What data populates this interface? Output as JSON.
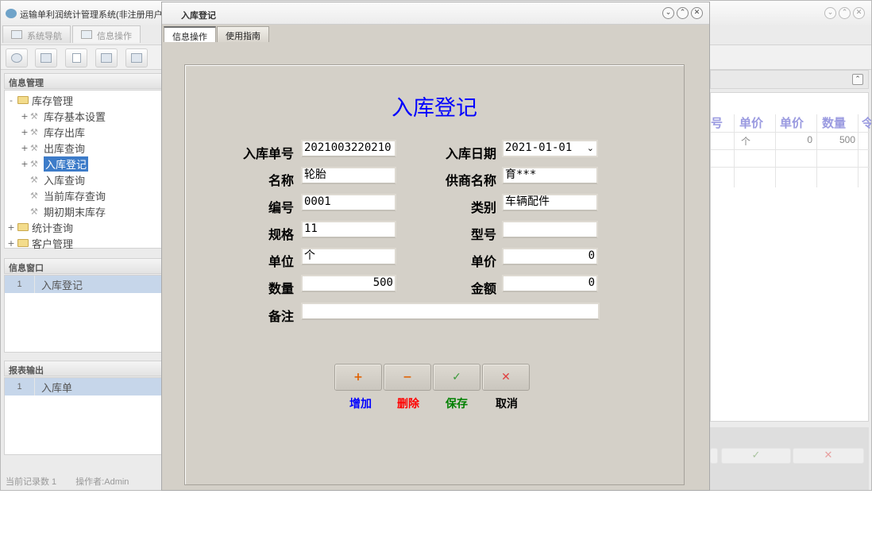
{
  "main_window": {
    "title": "运输单利润统计管理系统(非注册用户",
    "window_buttons": [
      "⌄",
      "⌃",
      "✕"
    ],
    "tabs": [
      {
        "label": "系统导航",
        "active": false
      },
      {
        "label": "信息操作",
        "active": true
      }
    ],
    "left_panel": {
      "info_management_header": "信息管理",
      "tree": [
        {
          "label": "库存管理",
          "level": 0,
          "expander": "-",
          "icon": "folder-icon"
        },
        {
          "label": "库存基本设置",
          "level": 1,
          "expander": "+",
          "icon": "tools-icon"
        },
        {
          "label": "库存出库",
          "level": 1,
          "expander": "+",
          "icon": "tools-icon"
        },
        {
          "label": "出库查询",
          "level": 1,
          "expander": "+",
          "icon": "tools-icon"
        },
        {
          "label": "入库登记",
          "level": 1,
          "expander": "+",
          "icon": "tools-icon",
          "selected": true
        },
        {
          "label": "入库查询",
          "level": 1,
          "expander": "",
          "icon": "tools-icon"
        },
        {
          "label": "当前库存查询",
          "level": 1,
          "expander": "",
          "icon": "tools-icon"
        },
        {
          "label": "期初期末库存",
          "level": 1,
          "expander": "",
          "icon": "tools-icon"
        },
        {
          "label": "统计查询",
          "level": 0,
          "expander": "+",
          "icon": "folder-icon"
        },
        {
          "label": "客户管理",
          "level": 0,
          "expander": "+",
          "icon": "folder-icon"
        }
      ],
      "info_window_header": "信息窗口",
      "info_window_rows": [
        {
          "index": "1",
          "label": "入库登记"
        }
      ],
      "report_header": "报表输出",
      "report_rows": [
        {
          "index": "1",
          "label": "入库单"
        }
      ]
    },
    "status_bar": {
      "record_count": "当前记录数 1",
      "operator": "操作者:Admin"
    },
    "right_grid": {
      "collapse_icon": "⌃",
      "columns": [
        "号",
        "单价",
        "单价",
        "数量",
        "令"
      ],
      "row": {
        "unit": "个",
        "price": "0",
        "qty": "500"
      },
      "confirm_glyph": "✓",
      "cancel_glyph": "✕"
    }
  },
  "dialog": {
    "title": "入库登记",
    "window_buttons": [
      "⌄",
      "⌃",
      "✕"
    ],
    "tabs": [
      {
        "label": "信息操作",
        "active": true
      },
      {
        "label": "使用指南",
        "active": false
      }
    ],
    "form": {
      "heading": "入库登记",
      "fields": {
        "order_no": {
          "label": "入库单号",
          "value": "2021003220210"
        },
        "date": {
          "label": "入库日期",
          "value": "2021-01-01"
        },
        "name": {
          "label": "名称",
          "value": "轮胎"
        },
        "supplier": {
          "label": "供商名称",
          "value": "育***"
        },
        "code": {
          "label": "编号",
          "value": "0001"
        },
        "category": {
          "label": "类别",
          "value": "车辆配件"
        },
        "spec": {
          "label": "规格",
          "value": "11"
        },
        "model": {
          "label": "型号",
          "value": ""
        },
        "unit": {
          "label": "单位",
          "value": "个"
        },
        "unit_price": {
          "label": "单价",
          "value": "0"
        },
        "quantity": {
          "label": "数量",
          "value": "500"
        },
        "amount": {
          "label": "金额",
          "value": "0"
        },
        "remark": {
          "label": "备注",
          "value": ""
        }
      },
      "buttons": {
        "add": {
          "glyph": "+",
          "label": "增加",
          "color": "#0000ff",
          "glyph_color": "#e06000"
        },
        "delete": {
          "glyph": "−",
          "label": "删除",
          "color": "#ff0000",
          "glyph_color": "#e06000"
        },
        "save": {
          "glyph": "✓",
          "label": "保存",
          "color": "#008000",
          "glyph_color": "#3a9a3a"
        },
        "cancel": {
          "glyph": "✕",
          "label": "取消",
          "color": "#000000",
          "glyph_color": "#e04040"
        }
      }
    }
  }
}
